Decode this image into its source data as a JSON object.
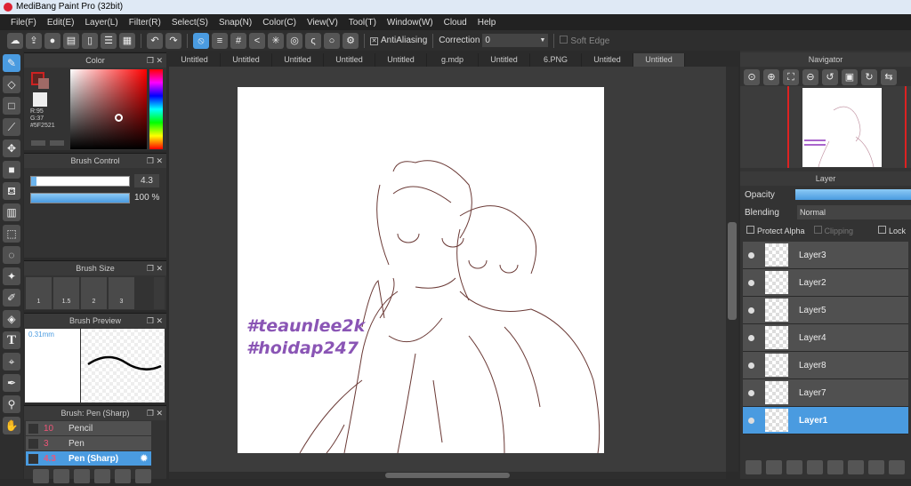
{
  "title": "MediBang Paint Pro (32bit)",
  "menu": [
    "File(F)",
    "Edit(E)",
    "Layer(L)",
    "Filter(R)",
    "Select(S)",
    "Snap(N)",
    "Color(C)",
    "View(V)",
    "Tool(T)",
    "Window(W)",
    "Cloud",
    "Help"
  ],
  "toolbar": {
    "antialiasing": "AntiAliasing",
    "correction_label": "Correction",
    "correction_value": "0",
    "soft_edge": "Soft Edge"
  },
  "color_panel": {
    "title": "Color",
    "r": "R:95",
    "g": "G:37",
    "hex": "#5F2521",
    "main_color": "#5f2521"
  },
  "brush_control": {
    "title": "Brush Control",
    "size": "4.3",
    "opacity": "100 %",
    "size_fraction": 0.04,
    "opacity_fraction": 1.0
  },
  "brush_size": {
    "title": "Brush Size",
    "sizes": [
      "1",
      "1.5",
      "2",
      "3"
    ]
  },
  "brush_preview": {
    "title": "Brush Preview",
    "size": "0.31mm"
  },
  "brush_list": {
    "title": "Brush: Pen (Sharp)",
    "items": [
      {
        "size": "10",
        "name": "Pencil"
      },
      {
        "size": "3",
        "name": "Pen"
      },
      {
        "size": "4.3",
        "name": "Pen (Sharp)"
      }
    ]
  },
  "tabs": [
    "Untitled",
    "Untitled",
    "Untitled",
    "Untitled",
    "Untitled",
    "g.mdp",
    "Untitled",
    "6.PNG",
    "Untitled",
    "Untitled"
  ],
  "artwork": {
    "text1": "#teaunlee2k",
    "text2": "#hoidap247"
  },
  "navigator": {
    "title": "Navigator"
  },
  "layer_panel": {
    "title": "Layer",
    "opacity_label": "Opacity",
    "blending_label": "Blending",
    "blending_value": "Normal",
    "protect_alpha": "Protect Alpha",
    "clipping": "Clipping",
    "lock": "Lock",
    "layers": [
      "Layer3",
      "Layer2",
      "Layer5",
      "Layer4",
      "Layer8",
      "Layer7",
      "Layer1"
    ]
  }
}
